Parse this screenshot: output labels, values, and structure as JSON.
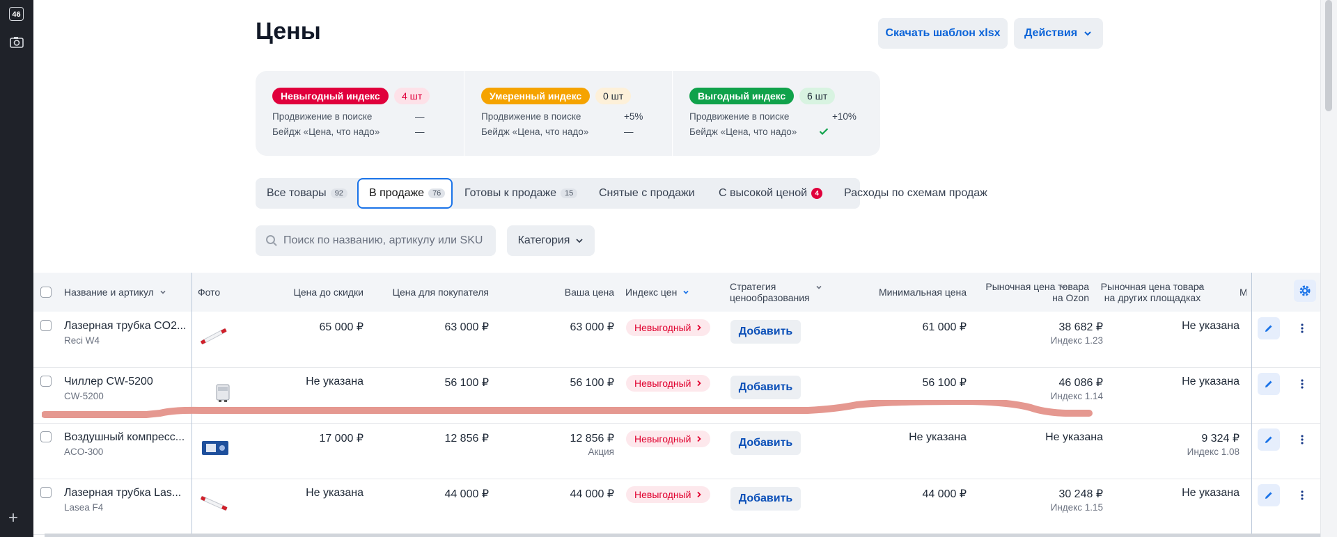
{
  "rail": {
    "badge": "46"
  },
  "page": {
    "title": "Цены",
    "download_template": "Скачать шаблон xlsx",
    "actions": "Действия"
  },
  "index_panel": [
    {
      "label": "Невыгодный индекс",
      "count": "4 шт",
      "color": "#e0003c",
      "count_bg": "#fde1e8",
      "count_color": "#e0003c",
      "search_label": "Продвижение в поиске",
      "search_value": "—",
      "badge_label": "Бейдж «Цена, что надо»",
      "badge_value": "—"
    },
    {
      "label": "Умеренный индекс",
      "count": "0 шт",
      "color": "#f5a300",
      "count_bg": "#fdf0d9",
      "count_color": "#1f2937",
      "search_label": "Продвижение в поиске",
      "search_value": "+5%",
      "badge_label": "Бейдж «Цена, что надо»",
      "badge_value": "—"
    },
    {
      "label": "Выгодный индекс",
      "count": "6 шт",
      "color": "#10a24b",
      "count_bg": "#d8f3e1",
      "count_color": "#1f2937",
      "search_label": "Продвижение в поиске",
      "search_value": "+10%",
      "badge_label": "Бейдж «Цена, что надо»",
      "badge_value": "check"
    }
  ],
  "tabs": [
    {
      "label": "Все товары",
      "count": "92"
    },
    {
      "label": "В продаже",
      "count": "76"
    },
    {
      "label": "Готовы к продаже",
      "count": "15"
    },
    {
      "label": "Снятые с продажи",
      "count": ""
    },
    {
      "label": "С высокой ценой",
      "count": "4"
    },
    {
      "label": "Расходы по схемам продаж",
      "count": ""
    }
  ],
  "search": {
    "placeholder": "Поиск по названию, артикулу или SKU"
  },
  "category": "Категория",
  "columns": {
    "name": "Название и артикул",
    "photo": "Фото",
    "price_before": "Цена до скидки",
    "price_buyer": "Цена для покупателя",
    "your_price": "Ваша цена",
    "price_index": "Индекс цен",
    "strategy_1": "Стратегия",
    "strategy_2": "ценообразования",
    "min_price": "Минимальная цена",
    "market_ozon_1": "Рыночная цена товара",
    "market_ozon_2": "на Ozon",
    "market_other_1": "Рыночная цена товара",
    "market_other_2": "на других площадках",
    "cut": "Мо"
  },
  "rows": [
    {
      "name": "Лазерная трубка CO2...",
      "sku": "Reci W4",
      "price_before": "65 000 ₽",
      "price_buyer": "63 000 ₽",
      "your_price": "63 000 ₽",
      "your_price_note": "",
      "index": "Невыгодный",
      "add": "Добавить",
      "min_price": "61 000 ₽",
      "ozon_price": "38 682 ₽",
      "ozon_index": "Индекс 1.23",
      "other_price": "Не указана",
      "other_index": "",
      "photo_icon": "laser-tube-image"
    },
    {
      "name": "Чиллер CW-5200",
      "sku": "CW-5200",
      "price_before": "Не указана",
      "price_buyer": "56 100 ₽",
      "your_price": "56 100 ₽",
      "your_price_note": "",
      "index": "Невыгодный",
      "add": "Добавить",
      "min_price": "56 100 ₽",
      "ozon_price": "46 086 ₽",
      "ozon_index": "Индекс 1.14",
      "other_price": "Не указана",
      "other_index": "",
      "photo_icon": "chiller-image"
    },
    {
      "name": "Воздушный компресс...",
      "sku": "ACO-300",
      "price_before": "17 000 ₽",
      "price_buyer": "12 856 ₽",
      "your_price": "12 856 ₽",
      "your_price_note": "Акция",
      "index": "Невыгодный",
      "add": "Добавить",
      "min_price": "Не указана",
      "ozon_price": "Не указана",
      "ozon_index": "",
      "other_price": "9 324 ₽",
      "other_index": "Индекс 1.08",
      "photo_icon": "compressor-image"
    },
    {
      "name": "Лазерная трубка Las...",
      "sku": "Lasea F4",
      "price_before": "Не указана",
      "price_buyer": "44 000 ₽",
      "your_price": "44 000 ₽",
      "your_price_note": "",
      "index": "Невыгодный",
      "add": "Добавить",
      "min_price": "44 000 ₽",
      "ozon_price": "30 248 ₽",
      "ozon_index": "Индекс 1.15",
      "other_price": "Не указана",
      "other_index": "",
      "photo_icon": "laser-tube-image"
    }
  ],
  "colors": {
    "accent": "#1a73e8",
    "link": "#0a63d8",
    "danger": "#e0002e",
    "annotation": "#e4928a"
  }
}
